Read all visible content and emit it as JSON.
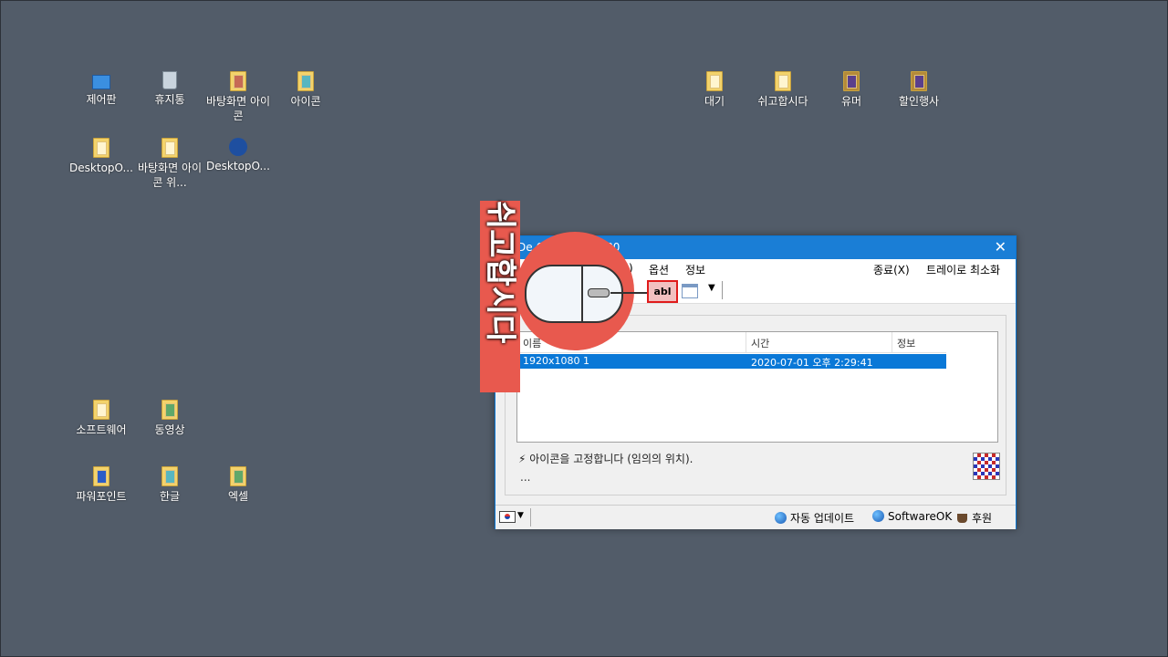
{
  "desktop": {
    "icons": [
      {
        "label": "제어판"
      },
      {
        "label": "휴지통"
      },
      {
        "label": "바탕화면 아이콘"
      },
      {
        "label": "아이콘"
      },
      {
        "label": "DesktopO..."
      },
      {
        "label": "바탕화면 아이콘 위..."
      },
      {
        "label": "DesktopO..."
      },
      {
        "label": "대기"
      },
      {
        "label": "쉬고합시다"
      },
      {
        "label": "유머"
      },
      {
        "label": "할인행사"
      },
      {
        "label": "소프트웨어"
      },
      {
        "label": "동영상"
      },
      {
        "label": "파워포인트"
      },
      {
        "label": "한글"
      },
      {
        "label": "엑셀"
      }
    ]
  },
  "window": {
    "title": "De        64) 1920x1080",
    "close": "✕",
    "menu": {
      "item1": ")",
      "options": "옵션",
      "info": "정보",
      "exit": "종료(X)",
      "tray": "트레이로 최소화"
    },
    "toolbar": {
      "abl": "abl",
      "dropdown": "▼"
    },
    "list": {
      "headers": {
        "name": "이름",
        "time": "시간",
        "info": "정보"
      },
      "rows": [
        {
          "name": "1920x1080 1",
          "time": "2020-07-01 오후 2:29:41",
          "info": ""
        }
      ]
    },
    "status_line": "아이콘을 고정합니다 (임의의 위치).",
    "dots": "...",
    "statusbar": {
      "arrow": "▼",
      "auto_update": "자동 업데이트",
      "softwareok": "SoftwareOK",
      "donate": "후원"
    }
  },
  "overlay": {
    "banner_text": "쉬고합시다"
  }
}
